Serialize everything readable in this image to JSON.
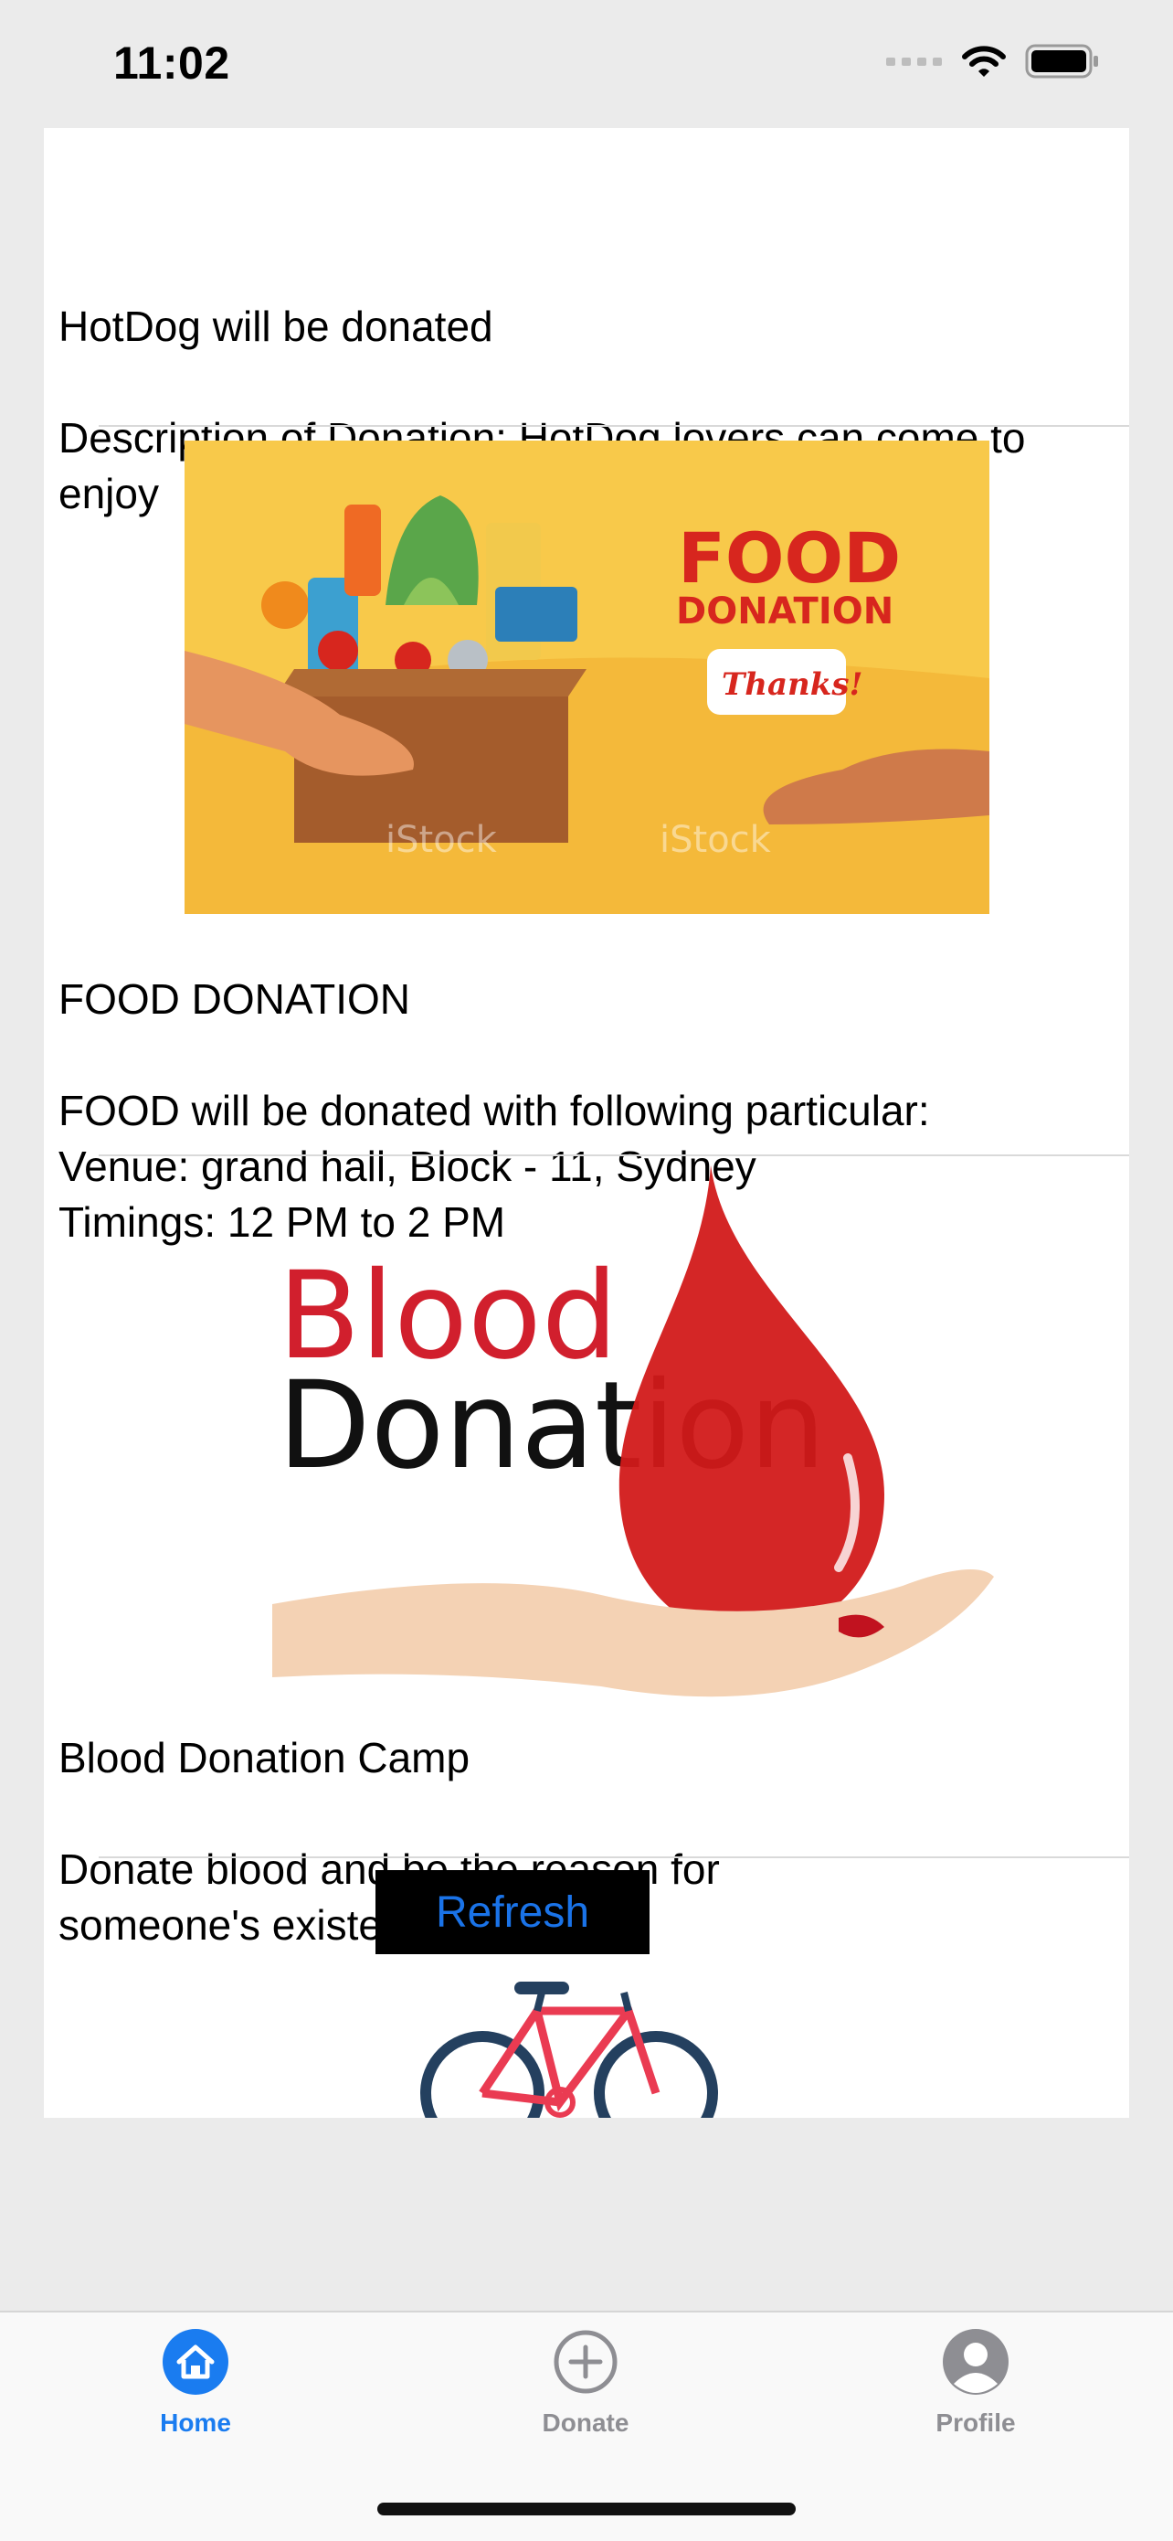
{
  "status_bar": {
    "time": "11:02",
    "icons": [
      "signal-dots-icon",
      "wifi-icon",
      "battery-icon"
    ]
  },
  "feed": {
    "items": [
      {
        "title": "HotDog will be donated",
        "description": " Description of Donation: HotDog lovers can come to enjoy"
      },
      {
        "title": "FOOD DONATION",
        "description": " FOOD will be donated with following particular:\nVenue: grand hall, Block - 11, Sydney\nTimings: 12 PM to 2 PM",
        "image": {
          "headline_line1": "FOOD",
          "headline_line2": "DONATION",
          "bubble": "Thanks!",
          "watermark": "iStock"
        }
      },
      {
        "title": "Blood Donation Camp",
        "description": "Donate blood and be the reason for\nsomeone's existence.",
        "image": {
          "word1": "Blood",
          "word2": "Donation"
        }
      }
    ],
    "refresh_label": "Refresh"
  },
  "tab_bar": {
    "tabs": [
      {
        "label": "Home",
        "icon": "home-icon",
        "active": true
      },
      {
        "label": "Donate",
        "icon": "plus-circle-icon",
        "active": false
      },
      {
        "label": "Profile",
        "icon": "profile-icon",
        "active": false
      }
    ]
  },
  "colors": {
    "accent": "#1a7cf0",
    "inactive": "#8e8e93",
    "blood_red": "#c8102e"
  }
}
